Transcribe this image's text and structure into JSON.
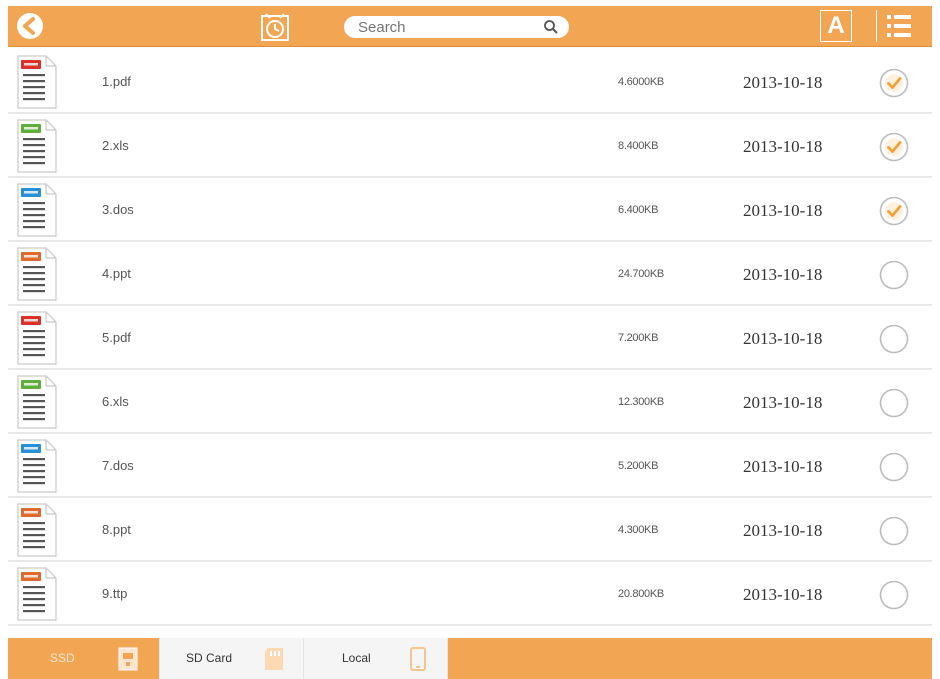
{
  "toolbar": {
    "back_icon": "back-arrow-icon",
    "history_icon": "alarm-clock-icon",
    "search": {
      "placeholder": "Search",
      "value": "",
      "icon": "search-icon"
    },
    "font_label": "A",
    "menu_icon": "list-view-icon"
  },
  "colors": {
    "accent": "#f2a654",
    "pdf": "#d9322b",
    "xls": "#5fae3a",
    "docs": "#2a8fd6",
    "ppt": "#e06a2c",
    "check": "#f0a13c",
    "divider": "#e9e9e9"
  },
  "files": [
    {
      "name": "1.pdf",
      "size": "4.6000KB",
      "date": "2013-10-18",
      "type_badge": "PDF",
      "checked": true
    },
    {
      "name": "2.xls",
      "size": "8.400KB",
      "date": "2013-10-18",
      "type_badge": "XLS",
      "checked": true
    },
    {
      "name": "3.dos",
      "size": "6.400KB",
      "date": "2013-10-18",
      "type_badge": "DOCS",
      "checked": true
    },
    {
      "name": "4.ppt",
      "size": "24.700KB",
      "date": "2013-10-18",
      "type_badge": "PPT",
      "checked": false
    },
    {
      "name": "5.pdf",
      "size": "7.200KB",
      "date": "2013-10-18",
      "type_badge": "PDF",
      "checked": false
    },
    {
      "name": "6.xls",
      "size": "12.300KB",
      "date": "2013-10-18",
      "type_badge": "XLS",
      "checked": false
    },
    {
      "name": "7.dos",
      "size": "5.200KB",
      "date": "2013-10-18",
      "type_badge": "DOCS",
      "checked": false
    },
    {
      "name": "8.ppt",
      "size": "4.300KB",
      "date": "2013-10-18",
      "type_badge": "PPT",
      "checked": false
    },
    {
      "name": "9.ttp",
      "size": "20.800KB",
      "date": "2013-10-18",
      "type_badge": "PPT",
      "checked": false
    }
  ],
  "tabs": [
    {
      "label": "SSD",
      "icon": "ssd-icon",
      "active": true
    },
    {
      "label": "SD Card",
      "icon": "sd-card-icon",
      "active": false
    },
    {
      "label": "Local",
      "icon": "phone-icon",
      "active": false
    }
  ]
}
